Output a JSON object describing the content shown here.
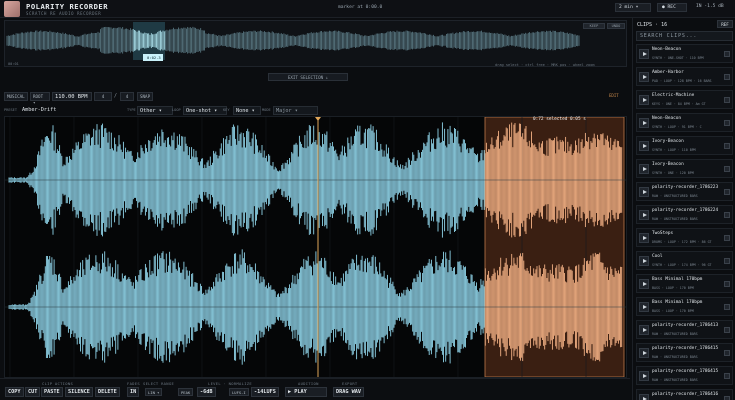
{
  "app": {
    "title": "POLARITY RECORDER",
    "subtitle": "SCRATCH RE AUDIO RECORDER",
    "marker": "marker at 0:00.0",
    "duration": "2 min",
    "rec_label": "● REC",
    "in_level": "IN -1.5 dB"
  },
  "overview": {
    "btn1": "KEEP",
    "btn2": "UNDO",
    "label": "00:01",
    "hint": "drag select · ctrl free · MRK pos · wheel zoom",
    "sel_label": "0:02.3",
    "exit_selection": "EXIT SELECTION  ↓"
  },
  "toolbar": {
    "musical": "MUSICAL",
    "root": "ROOT ▾",
    "bpm": "110.00 BPM",
    "beats": "4",
    "slash": "/",
    "sig": "4",
    "snap": "SNAP",
    "edit": "EDIT"
  },
  "meta": {
    "name_label": "PRESET",
    "name": "Amber-Drift",
    "type_label": "TYPE",
    "type": "Other",
    "mode_label": "LOOP",
    "mode": "One-shot",
    "key_label": "KEY",
    "key": "None",
    "scale_label": "MODE",
    "scale": "Major"
  },
  "wave": {
    "sel_label": "0:72 selected    0:05 s"
  },
  "bottom": {
    "clip_actions": "CLIP ACTIONS",
    "copy": "COPY",
    "cut": "CUT",
    "paste": "PASTE",
    "silence": "SILENCE",
    "delete": "DELETE",
    "fades": "FADES",
    "select_range": "SELECT RANGE",
    "fade_in": "IN",
    "fade_lin": "LIN ▾",
    "level": "LEVEL · NORMALIZE",
    "peak": "PEAK",
    "db": "-6dB",
    "lufs_btn": "LUFS-I",
    "lufs": "-14LUFS",
    "audition": "AUDITION",
    "play": "▶ PLAY",
    "export": "EXPORT",
    "drag": "DRAG WAV"
  },
  "clips": {
    "title": "CLIPS · 16",
    "ref": "REF",
    "search_placeholder": "SEARCH CLIPS...",
    "items": [
      {
        "name": "Neon-Beacon",
        "tags": "SYNTH · ONE-SHOT · 110 BPM"
      },
      {
        "name": "Amber-Harbor",
        "tags": "PAD · LOOP · 128 BPM · 16 BARS"
      },
      {
        "name": "Electric-Machine",
        "tags": "KEYS · ONE · 84 BPM · Am GT"
      },
      {
        "name": "Neon-Beacon",
        "tags": "SYNTH · LOOP · 91 BPM · C"
      },
      {
        "name": "Ivory-Beacon",
        "tags": "SYNTH · LOOP · 110 BPM"
      },
      {
        "name": "Ivory-Beacon",
        "tags": "SYNTH · ONE · 120 BPM"
      },
      {
        "name": "polarity-recorder_1786223",
        "tags": "RAW · UNSTRUCTURED BARS"
      },
      {
        "name": "polarity-recorder_1786224",
        "tags": "RAW · UNSTRUCTURED BARS"
      },
      {
        "name": "TwoSteps",
        "tags": "DRUMS · LOOP · 172 BPM · 86 GT"
      },
      {
        "name": "Cool",
        "tags": "SYNTH · LOOP · 174 BPM · 96 GT"
      },
      {
        "name": "Bass Minimal 170bpm",
        "tags": "BASS · LOOP · 170 BPM"
      },
      {
        "name": "Bass Minimal 170bpm",
        "tags": "BASS · LOOP · 170 BPM"
      },
      {
        "name": "polarity-recorder_1786413",
        "tags": "RAW · UNSTRUCTURED BARS"
      },
      {
        "name": "polarity-recorder_1786415",
        "tags": "RAW · UNSTRUCTURED BARS"
      },
      {
        "name": "polarity-recorder_1786415",
        "tags": "RAW · UNSTRUCTURED BARS"
      },
      {
        "name": "polarity-recorder_1786416",
        "tags": "RAW · UNSTRUCTURED BARS"
      }
    ]
  },
  "colors": {
    "wave": "#8fd3e8",
    "selection": "#f2b084",
    "selection_bg": "#3a1f12",
    "marker": "#e0a75a"
  }
}
